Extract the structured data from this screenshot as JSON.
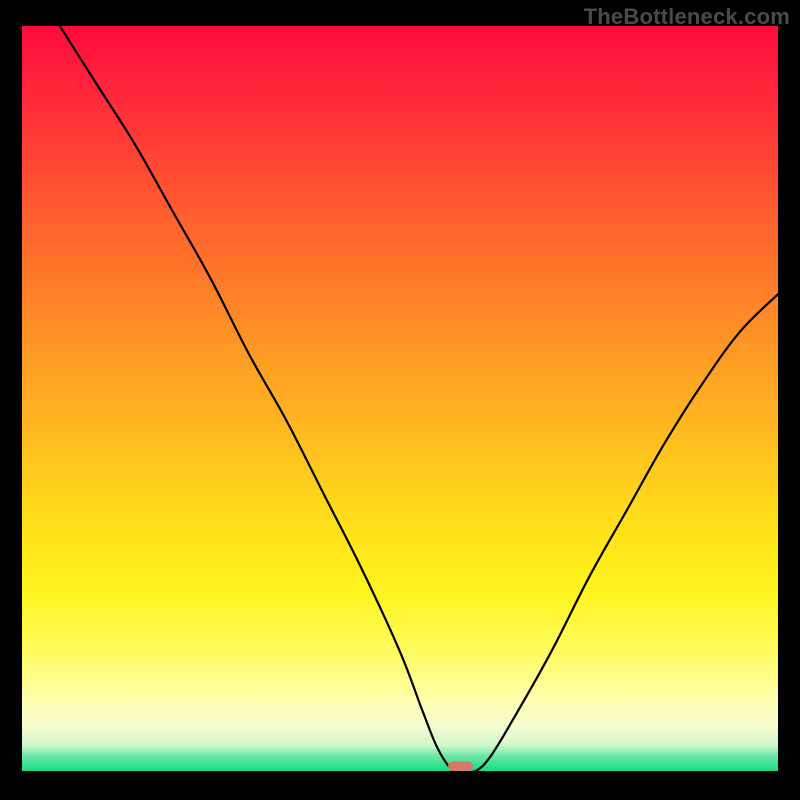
{
  "watermark": "TheBottleneck.com",
  "chart_data": {
    "type": "line",
    "title": "",
    "xlabel": "",
    "ylabel": "",
    "xlim": [
      0,
      100
    ],
    "ylim": [
      0,
      100
    ],
    "grid": false,
    "legend": false,
    "background_gradient": {
      "orientation": "vertical",
      "stops": [
        {
          "pos": 0.0,
          "color": "#ff0a3e"
        },
        {
          "pos": 0.22,
          "color": "#ff5330"
        },
        {
          "pos": 0.46,
          "color": "#ffa024"
        },
        {
          "pos": 0.68,
          "color": "#ffe21a"
        },
        {
          "pos": 0.84,
          "color": "#fffc60"
        },
        {
          "pos": 0.94,
          "color": "#f6fcd0"
        },
        {
          "pos": 0.98,
          "color": "#6de6a5"
        },
        {
          "pos": 1.0,
          "color": "#10df84"
        }
      ]
    },
    "series": [
      {
        "name": "bottleneck-curve",
        "x": [
          5,
          10,
          15,
          20,
          25,
          30,
          35,
          40,
          45,
          50,
          53,
          55,
          57,
          58,
          60,
          62,
          65,
          70,
          75,
          80,
          85,
          90,
          95,
          100
        ],
        "y": [
          100,
          92,
          84,
          75,
          66,
          56,
          47,
          37,
          27,
          16,
          8,
          3,
          0,
          0,
          0,
          2,
          7,
          16,
          26,
          35,
          44,
          52,
          59,
          64
        ]
      }
    ],
    "marker": {
      "name": "optimal-point",
      "shape": "rounded-rect",
      "x": 58,
      "y": 0,
      "width_pct": 3.3,
      "height_pct": 1.3,
      "color": "#d6786c"
    }
  }
}
